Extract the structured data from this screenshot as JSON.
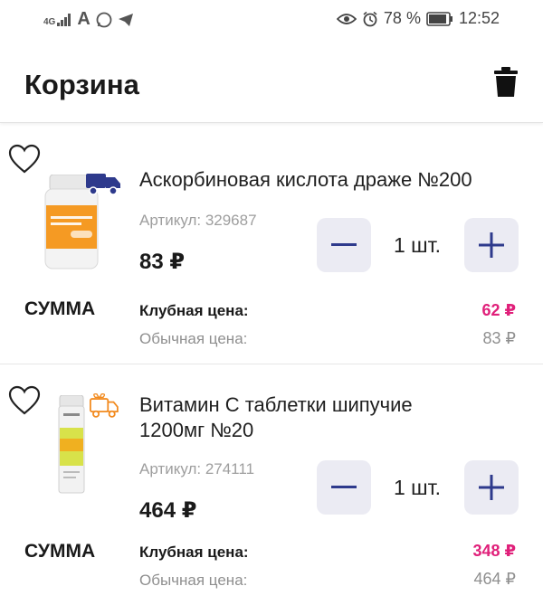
{
  "status_bar": {
    "network": "4G",
    "battery": "78 %",
    "time": "12:52",
    "icons": [
      "signal-icon",
      "font-a-icon",
      "whatsapp-icon",
      "telegram-icon",
      "eye-icon",
      "alarm-icon",
      "battery-icon"
    ]
  },
  "header": {
    "title": "Корзина",
    "delete_icon": "trash-icon"
  },
  "cart": {
    "items": [
      {
        "name": "Аскорбиновая кислота драже №200",
        "article": "Артикул: 329687",
        "price": "83 ₽",
        "quantity": "1 шт.",
        "delivery_icon": "delivery-truck-icon",
        "summary": {
          "label": "СУММА",
          "club_label": "Клубная цена:",
          "club_value": "62 ₽",
          "regular_label": "Обычная цена:",
          "regular_value": "83 ₽"
        }
      },
      {
        "name_line1": "Витамин С таблетки шипучие",
        "name_line2": "1200мг №20",
        "article": "Артикул: 274111",
        "price": "464 ₽",
        "quantity": "1 шт.",
        "delivery_icon": "gift-truck-icon",
        "summary": {
          "label": "СУММА",
          "club_label": "Клубная цена:",
          "club_value": "348 ₽",
          "regular_label": "Обычная цена:",
          "regular_value": "464 ₽"
        }
      }
    ]
  },
  "colors": {
    "accent": "#2e3a8c",
    "club_price": "#e0207a",
    "qty_button_bg": "#ebebf3",
    "muted": "#8f8f8f"
  }
}
